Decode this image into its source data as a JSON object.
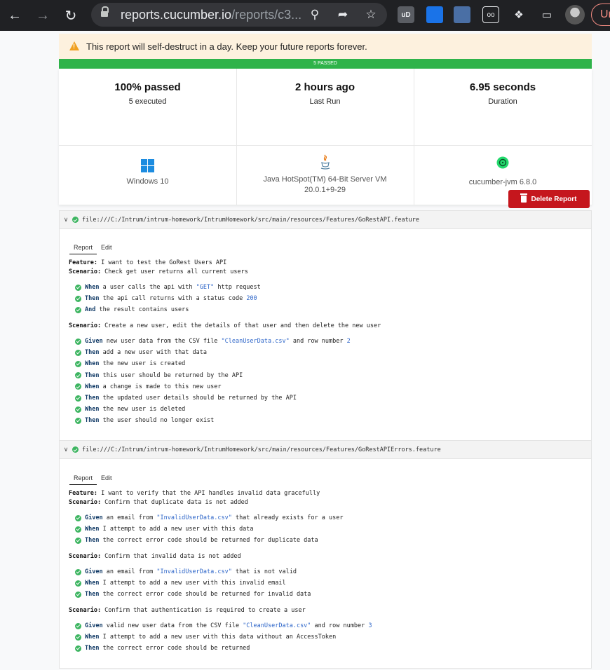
{
  "browser": {
    "url_host": "reports.cucumber.io",
    "url_path": "/reports/c3...",
    "profile_label": "Ur"
  },
  "banner": {
    "warning": "This report will self-destruct in a day. Keep your future reports forever."
  },
  "passbar": {
    "label": "5 PASSED",
    "color": "#2fb34a"
  },
  "stats": {
    "passed": {
      "main": "100% passed",
      "sub": "5 executed"
    },
    "last_run": {
      "main": "2 hours ago",
      "sub": "Last Run"
    },
    "duration": {
      "main": "6.95 seconds",
      "sub": "Duration"
    },
    "os": "Windows 10",
    "runtime_line1": "Java HotSpot(TM) 64-Bit Server VM",
    "runtime_line2": "20.0.1+9-29",
    "implementation": "cucumber-jvm 6.8.0"
  },
  "actions": {
    "delete_label": "Delete Report",
    "delete_color": "#c5161d"
  },
  "features": [
    {
      "path": "file:///C:/Intrum/intrum-homework/IntrumHomework/src/main/resources/Features/GoRestAPI.feature",
      "tabs": [
        "Report",
        "Edit"
      ],
      "feature_kw": "Feature:",
      "feature_title": "I want to test the GoRest Users API",
      "scenarios": [
        {
          "kw": "Scenario:",
          "title": "Check get user returns all current users",
          "steps": [
            {
              "kw": "When",
              "parts": [
                " a user calls the api with ",
                "\"GET\"",
                " http request"
              ]
            },
            {
              "kw": "Then",
              "parts": [
                " the api call returns with a status code ",
                "200",
                ""
              ]
            },
            {
              "kw": "And",
              "parts": [
                " the result contains users",
                "",
                ""
              ]
            }
          ]
        },
        {
          "kw": "Scenario:",
          "title": "Create a new user, edit the details of that user and then delete the new user",
          "steps": [
            {
              "kw": "Given",
              "parts": [
                " new user data from the CSV file ",
                "\"CleanUserData.csv\"",
                " and row number ",
                "2"
              ]
            },
            {
              "kw": "Then",
              "parts": [
                " add a new user with that data",
                "",
                ""
              ]
            },
            {
              "kw": "When",
              "parts": [
                " the new user is created",
                "",
                ""
              ]
            },
            {
              "kw": "Then",
              "parts": [
                " this user should be returned by the API",
                "",
                ""
              ]
            },
            {
              "kw": "When",
              "parts": [
                " a change is made to this new user",
                "",
                ""
              ]
            },
            {
              "kw": "Then",
              "parts": [
                " the updated user details should be returned by the API",
                "",
                ""
              ]
            },
            {
              "kw": "When",
              "parts": [
                " the new user is deleted",
                "",
                ""
              ]
            },
            {
              "kw": "Then",
              "parts": [
                " the user should no longer exist",
                "",
                ""
              ]
            }
          ]
        }
      ]
    },
    {
      "path": "file:///C:/Intrum/intrum-homework/IntrumHomework/src/main/resources/Features/GoRestAPIErrors.feature",
      "tabs": [
        "Report",
        "Edit"
      ],
      "feature_kw": "Feature:",
      "feature_title": "I want to verify that the API handles invalid data gracefully",
      "scenarios": [
        {
          "kw": "Scenario:",
          "title": "Confirm that duplicate data is not added",
          "steps": [
            {
              "kw": "Given",
              "parts": [
                " an email from ",
                "\"InvalidUserData.csv\"",
                " that already exists for a user"
              ]
            },
            {
              "kw": "When",
              "parts": [
                " I attempt to add a new user with this data",
                "",
                ""
              ]
            },
            {
              "kw": "Then",
              "parts": [
                " the correct error code should be returned for duplicate data",
                "",
                ""
              ]
            }
          ]
        },
        {
          "kw": "Scenario:",
          "title": "Confirm that invalid data is not added",
          "steps": [
            {
              "kw": "Given",
              "parts": [
                " an email from ",
                "\"InvalidUserData.csv\"",
                " that is not valid"
              ]
            },
            {
              "kw": "When",
              "parts": [
                " I attempt to add a new user with this invalid email",
                "",
                ""
              ]
            },
            {
              "kw": "Then",
              "parts": [
                " the correct error code should be returned for invalid data",
                "",
                ""
              ]
            }
          ]
        },
        {
          "kw": "Scenario:",
          "title": "Confirm that authentication is required to create a user",
          "steps": [
            {
              "kw": "Given",
              "parts": [
                " valid new user data from the CSV file ",
                "\"CleanUserData.csv\"",
                " and row number ",
                "3"
              ]
            },
            {
              "kw": "When",
              "parts": [
                " I attempt to add a new user with this data without an AccessToken",
                "",
                ""
              ]
            },
            {
              "kw": "Then",
              "parts": [
                " the correct error code should be returned",
                "",
                ""
              ]
            }
          ]
        }
      ]
    }
  ]
}
